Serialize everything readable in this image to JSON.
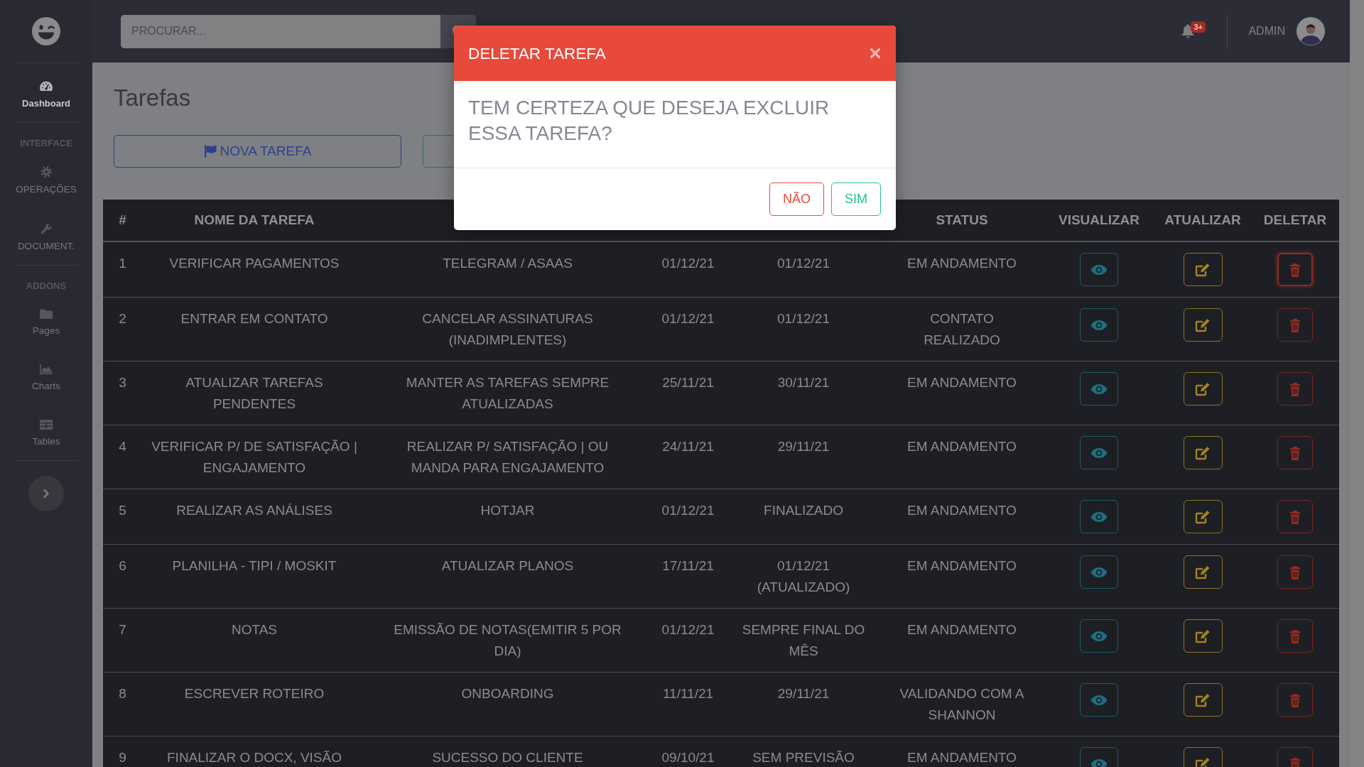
{
  "sidebar": {
    "sections": [
      {
        "items": [
          {
            "label": "Dashboard",
            "selected": true
          }
        ]
      },
      {
        "heading": "INTERFACE",
        "items": [
          {
            "label": "OPERAÇÕES",
            "selected": false
          },
          {
            "label": "DOCUMENT.",
            "selected": false
          }
        ]
      },
      {
        "heading": "ADDONS",
        "items": [
          {
            "label": "Pages",
            "selected": false
          },
          {
            "label": "Charts",
            "selected": false
          },
          {
            "label": "Tables",
            "selected": false
          }
        ]
      }
    ]
  },
  "topbar": {
    "search": {
      "placeholder": "PROCURAR..."
    },
    "notifications": {
      "badge": "3+"
    },
    "user": {
      "name": "ADMIN"
    }
  },
  "page": {
    "title": "Tarefas",
    "buttons": [
      {
        "kind": "primary",
        "label": "NOVA TAREFA"
      },
      {
        "kind": "success"
      }
    ]
  },
  "table": {
    "columns": {
      "number": "#",
      "name": "NOME DA TAREFA",
      "status": "STATUS",
      "view": "VISUALIZAR",
      "update": "ATUALIZAR",
      "delete": "DELETAR"
    },
    "rows": [
      {
        "number": "1",
        "name": "VERIFICAR PAGAMENTOS",
        "column_3": "TELEGRAM / ASAAS",
        "column_4": "01/12/21",
        "column_5": "01/12/21",
        "status": "EM ANDAMENTO",
        "delete_focused": true
      },
      {
        "number": "2",
        "name": "ENTRAR EM CONTATO",
        "column_3": "CANCELAR ASSINATURAS (INADIMPLENTES)",
        "column_4": "01/12/21",
        "column_5": "01/12/21",
        "status": "CONTATO REALIZADO",
        "delete_focused": false
      },
      {
        "number": "3",
        "name": "ATUALIZAR TAREFAS PENDENTES",
        "column_3": "MANTER AS TAREFAS SEMPRE ATUALIZADAS",
        "column_4": "25/11/21",
        "column_5": "30/11/21",
        "status": "EM ANDAMENTO",
        "delete_focused": false
      },
      {
        "number": "4",
        "name": "VERIFICAR P/ DE SATISFAÇÃO | ENGAJAMENTO",
        "column_3": "REALIZAR P/ SATISFAÇÃO | OU MANDA PARA ENGAJAMENTO",
        "column_4": "24/11/21",
        "column_5": "29/11/21",
        "status": "EM ANDAMENTO",
        "delete_focused": false
      },
      {
        "number": "5",
        "name": "REALIZAR AS ANÁLISES",
        "column_3": "HOTJAR",
        "column_4": "01/12/21",
        "column_5": "FINALIZADO",
        "status": "EM ANDAMENTO",
        "delete_focused": false
      },
      {
        "number": "6",
        "name": "PLANILHA - TIPI / MOSKIT",
        "column_3": "ATUALIZAR PLANOS",
        "column_4": "17/11/21",
        "column_5": "01/12/21 (ATUALIZADO)",
        "status": "EM ANDAMENTO",
        "delete_focused": false
      },
      {
        "number": "7",
        "name": "NOTAS",
        "column_3": "EMISSÃO DE NOTAS(EMITIR 5 POR DIA)",
        "column_4": "01/12/21",
        "column_5": "SEMPRE FINAL DO MÊS",
        "status": "EM ANDAMENTO",
        "delete_focused": false
      },
      {
        "number": "8",
        "name": "ESCREVER ROTEIRO",
        "column_3": "ONBOARDING",
        "column_4": "11/11/21",
        "column_5": "29/11/21",
        "status": "VALIDANDO COM A SHANNON",
        "delete_focused": false
      },
      {
        "number": "9",
        "name": "FINALIZAR O DOCX, VISÃO",
        "column_3": "SUCESSO DO CLIENTE",
        "column_4": "09/10/21",
        "column_5": "SEM PREVISÃO",
        "status": "EM ANDAMENTO",
        "delete_focused": false
      }
    ]
  },
  "dialog": {
    "title": "DELETAR TAREFA",
    "message": "TEM CERTEZA QUE DESEJA EXCLUIR ESSA TAREFA?",
    "buttons": [
      {
        "kind": "danger",
        "label": "NÃO"
      },
      {
        "kind": "success",
        "label": "SIM"
      }
    ]
  }
}
